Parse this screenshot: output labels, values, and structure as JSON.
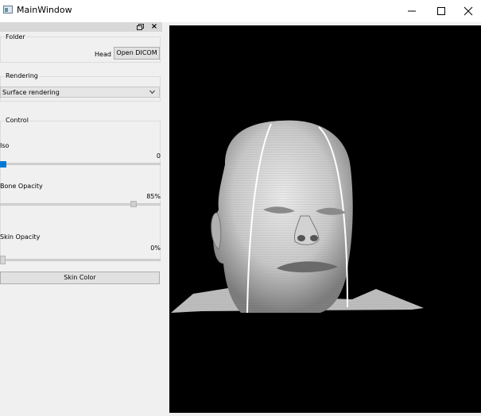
{
  "window": {
    "title": "MainWindow"
  },
  "dock": {
    "float_icon": "dock-float-icon",
    "close_icon": "dock-close-icon"
  },
  "folder": {
    "title": "Folder",
    "label": "Head",
    "open_button": "Open DICOM"
  },
  "rendering": {
    "title": "Rendering",
    "mode": "Surface rendering"
  },
  "control": {
    "title": "Control",
    "iso": {
      "label": "Iso",
      "value": "0",
      "level": 0.0
    },
    "bone_opacity": {
      "label": "Bone Opacity",
      "value": "85%",
      "level": 0.85
    },
    "skin_opacity": {
      "label": "Skin Opacity",
      "value": "0%",
      "level": 0.0
    },
    "skin_color_button": "Skin Color"
  },
  "colors": {
    "accent": "#0078d7",
    "viewport_bg": "#000000",
    "panel_bg": "#f0f0f0"
  }
}
